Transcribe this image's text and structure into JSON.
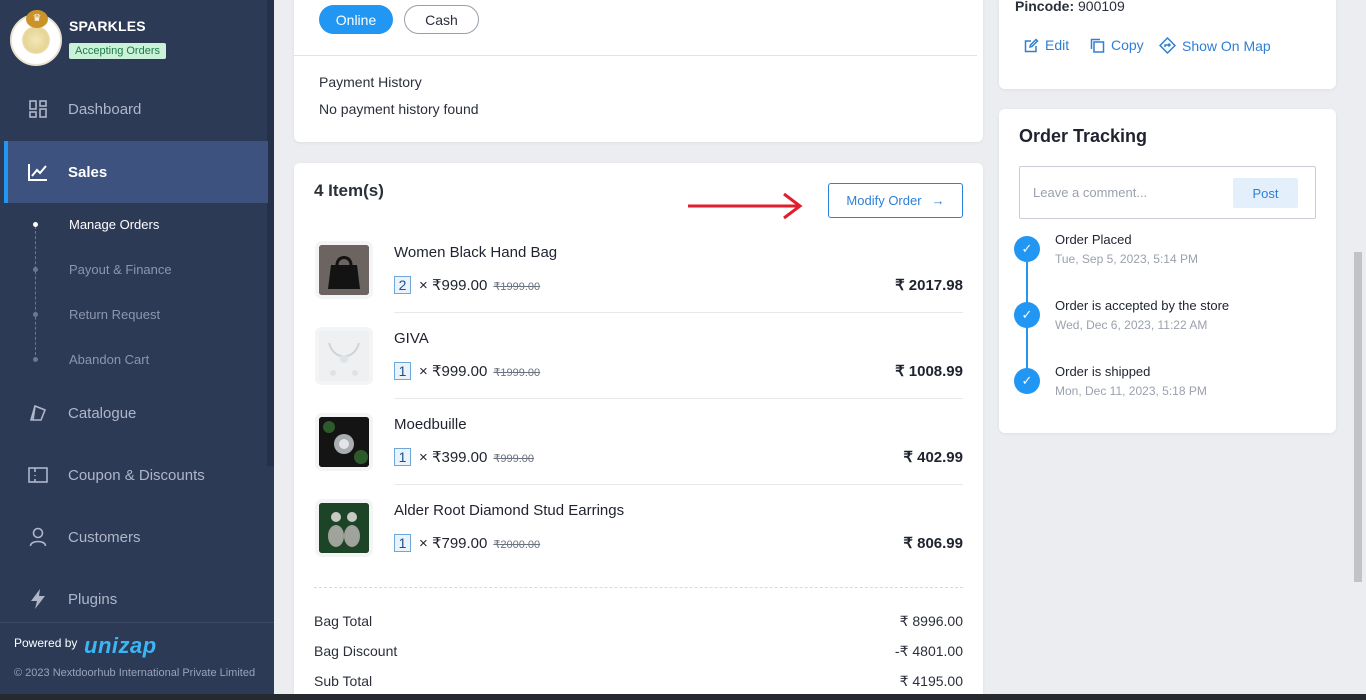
{
  "sidebar": {
    "store_name": "SPARKLES",
    "store_status": "Accepting Orders",
    "nav": [
      {
        "label": "Dashboard",
        "icon": "dashboard-icon"
      },
      {
        "label": "Sales",
        "icon": "chart-line-icon",
        "active": true
      },
      {
        "label": "Catalogue",
        "icon": "tag-icon"
      },
      {
        "label": "Coupon & Discounts",
        "icon": "coupon-icon"
      },
      {
        "label": "Customers",
        "icon": "user-icon"
      },
      {
        "label": "Plugins",
        "icon": "bolt-icon"
      }
    ],
    "sales_sub": [
      {
        "label": "Manage Orders",
        "active": true
      },
      {
        "label": "Payout & Finance"
      },
      {
        "label": "Return Request"
      },
      {
        "label": "Abandon Cart"
      }
    ],
    "powered_by": "Powered by",
    "brand_logo": "unizap",
    "copyright": "© 2023 Nextdoorhub International Private Limited"
  },
  "payment": {
    "methods": [
      "Online",
      "Cash"
    ],
    "selected": "Online",
    "history_title": "Payment History",
    "history_empty": "No payment history found"
  },
  "items": {
    "title": "4 Item(s)",
    "modify_label": "Modify Order",
    "list": [
      {
        "name": "Women Black Hand Bag",
        "qty": "2",
        "price": "₹999.00",
        "mrp": "₹1999.00",
        "total": "₹ 2017.98"
      },
      {
        "name": "GIVA",
        "qty": "1",
        "price": "₹999.00",
        "mrp": "₹1999.00",
        "total": "₹ 1008.99"
      },
      {
        "name": "Moedbuille",
        "qty": "1",
        "price": "₹399.00",
        "mrp": "₹999.00",
        "total": "₹ 402.99"
      },
      {
        "name": "Alder Root Diamond Stud Earrings",
        "qty": "1",
        "price": "₹799.00",
        "mrp": "₹2000.00",
        "total": "₹ 806.99"
      }
    ],
    "summary": [
      {
        "label": "Bag Total",
        "value": "₹ 8996.00"
      },
      {
        "label": "Bag Discount",
        "value": "-₹ 4801.00"
      },
      {
        "label": "Sub Total",
        "value": "₹ 4195.00"
      }
    ]
  },
  "address": {
    "pincode_label": "Pincode:",
    "pincode_value": "900109",
    "actions": [
      "Edit",
      "Copy",
      "Show On Map"
    ]
  },
  "tracking": {
    "title": "Order Tracking",
    "comment_placeholder": "Leave a comment...",
    "post_label": "Post",
    "events": [
      {
        "title": "Order Placed",
        "time": "Tue, Sep 5, 2023, 5:14 PM"
      },
      {
        "title": "Order is accepted by the store",
        "time": "Wed, Dec 6, 2023, 11:22 AM"
      },
      {
        "title": "Order is shipped",
        "time": "Mon, Dec 11, 2023, 5:18 PM"
      }
    ]
  },
  "colors": {
    "sidebar_bg": "#2d3a56",
    "active_nav": "#3e5280",
    "accent": "#2196f3",
    "link": "#2f7fd6",
    "annotation_arrow": "#e11d2e"
  }
}
